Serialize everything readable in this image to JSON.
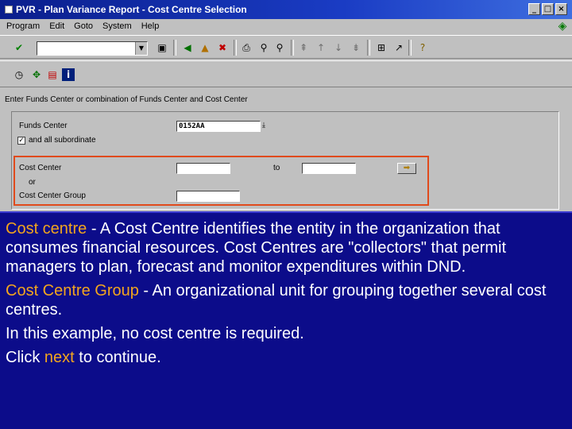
{
  "window": {
    "title": "PVR - Plan Variance Report - Cost Centre Selection",
    "buttons": [
      "_",
      "□",
      "×"
    ]
  },
  "menu": {
    "items": [
      "Program",
      "Edit",
      "Goto",
      "System",
      "Help"
    ]
  },
  "form": {
    "section_title": "Enter Funds Center or combination of Funds Center and Cost Center",
    "funds_center_label": "Funds Center",
    "funds_center_value": "0152AA",
    "all_subordinate_label": "and all subordinate",
    "all_subordinate_checked": true,
    "cost_center_label": "Cost Center",
    "to_label": "to",
    "or_label": "or",
    "cost_center_group_label": "Cost Center Group"
  },
  "overlay": {
    "p1_term": "Cost centre",
    "p1_text": " - A Cost Centre identifies the entity in the organization that consumes financial resources. Cost Centres are \"collectors\" that permit managers to plan, forecast and monitor expenditures within DND.",
    "p2_term": "Cost Centre Group",
    "p2_text": " - An organizational unit for grouping together several cost centres.",
    "p3_text": "In this example, no cost centre is required.",
    "p4_pre": "Click ",
    "p4_term": "next",
    "p4_post": " to continue."
  },
  "colors": {
    "overlay_bg": "#0c0c8a",
    "highlight": "#f2a51e",
    "title_bar": "#0a1e8c",
    "red_box": "#e04a1c"
  }
}
